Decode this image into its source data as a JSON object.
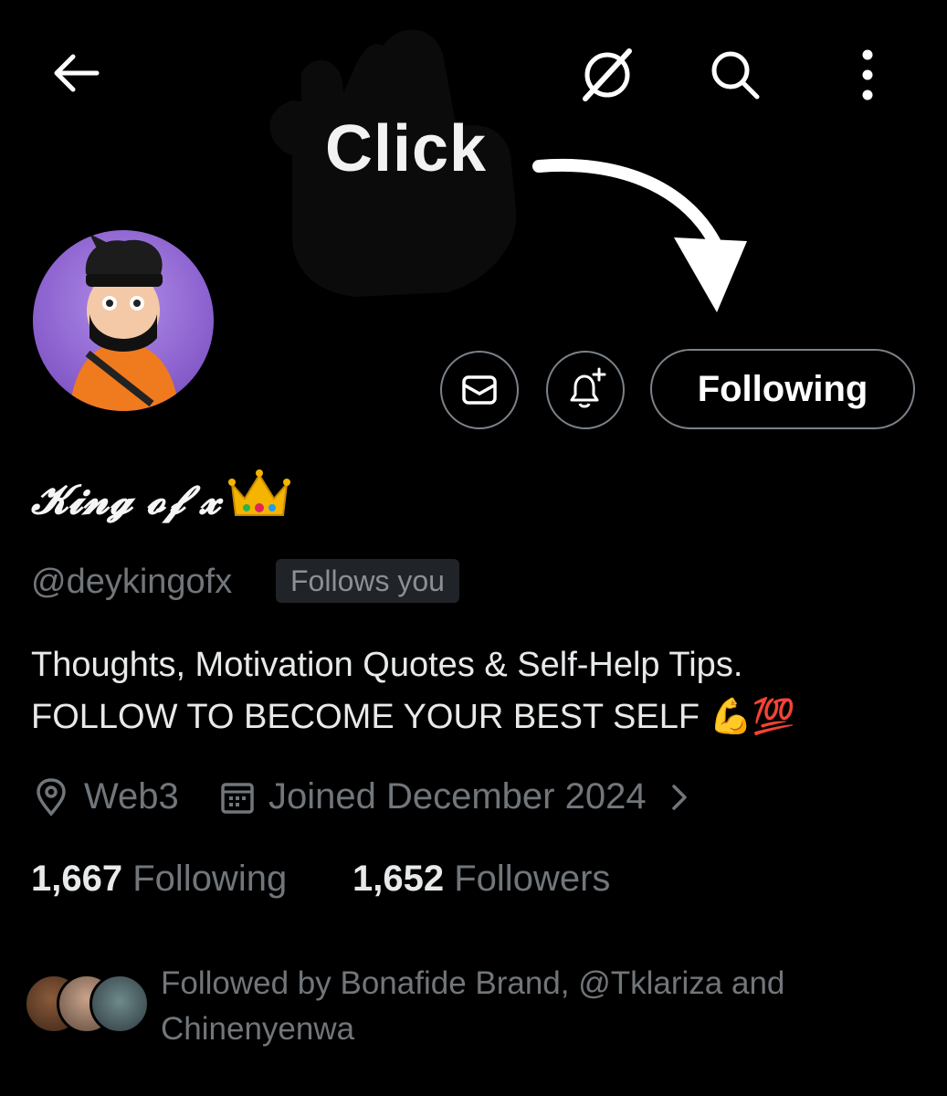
{
  "overlay": {
    "click_text": "Click"
  },
  "header": {
    "back_icon": "arrow-left-icon",
    "grok_icon": "grok-icon",
    "search_icon": "search-icon",
    "more_icon": "more-vertical-icon"
  },
  "profile": {
    "display_name": "𝓚𝓲𝓷𝓰 𝓸𝓯 𝔁",
    "name_emoji": "👑",
    "handle": "@deykingofx",
    "follows_you_label": "Follows you",
    "bio_line1": "Thoughts, Motivation Quotes & Self-Help Tips.",
    "bio_line2": "FOLLOW TO BECOME YOUR BEST SELF 💪💯",
    "location": "Web3",
    "joined": "Joined December 2024",
    "following_count": "1,667",
    "following_label": "Following",
    "followers_count": "1,652",
    "followers_label": "Followers",
    "followed_by": "Followed by Bonafide Brand, @Tklariza and Chinenyenwa"
  },
  "actions": {
    "message_icon": "mail-icon",
    "notify_icon": "bell-plus-icon",
    "follow_button_label": "Following"
  },
  "colors": {
    "background": "#000000",
    "muted": "#71767b",
    "border": "#7b8289"
  }
}
